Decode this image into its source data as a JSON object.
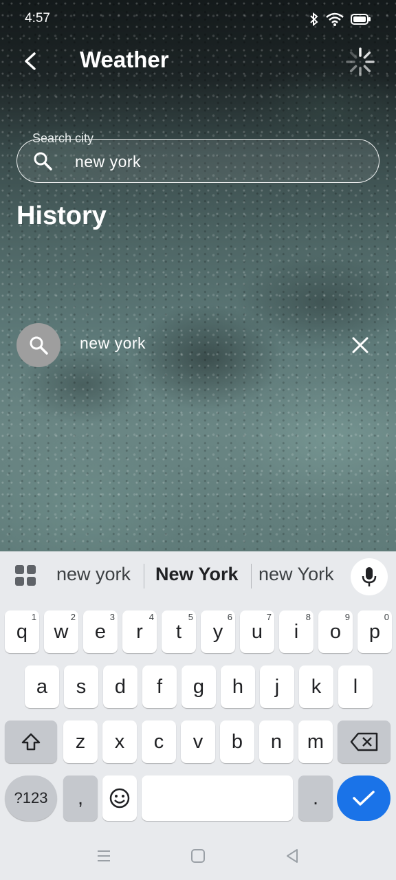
{
  "status": {
    "time": "4:57"
  },
  "app": {
    "title": "Weather"
  },
  "search": {
    "label": "Search city",
    "value": "new york",
    "placeholder": ""
  },
  "history": {
    "title": "History",
    "items": [
      {
        "label": "new york"
      }
    ]
  },
  "keyboard": {
    "suggestions": [
      "new york",
      "New York",
      "new York"
    ],
    "row1": [
      "q",
      "w",
      "e",
      "r",
      "t",
      "y",
      "u",
      "i",
      "o",
      "p"
    ],
    "row1_hints": [
      "1",
      "2",
      "3",
      "4",
      "5",
      "6",
      "7",
      "8",
      "9",
      "0"
    ],
    "row2": [
      "a",
      "s",
      "d",
      "f",
      "g",
      "h",
      "j",
      "k",
      "l"
    ],
    "row3": [
      "z",
      "x",
      "c",
      "v",
      "b",
      "n",
      "m"
    ],
    "symbols_label": "?123",
    "comma": ",",
    "period": "."
  },
  "colors": {
    "accent": "#1a73e8",
    "keyboard_bg": "#e8eaed",
    "avatar": "#9e9e9e"
  },
  "icons": [
    "back-arrow-icon",
    "loading-spinner-icon",
    "search-icon",
    "close-icon",
    "apps-grid-icon",
    "mic-icon",
    "shift-icon",
    "backspace-icon",
    "emoji-icon",
    "check-icon",
    "recents-icon",
    "home-icon",
    "back-nav-icon",
    "bluetooth-icon",
    "wifi-icon",
    "battery-icon"
  ]
}
